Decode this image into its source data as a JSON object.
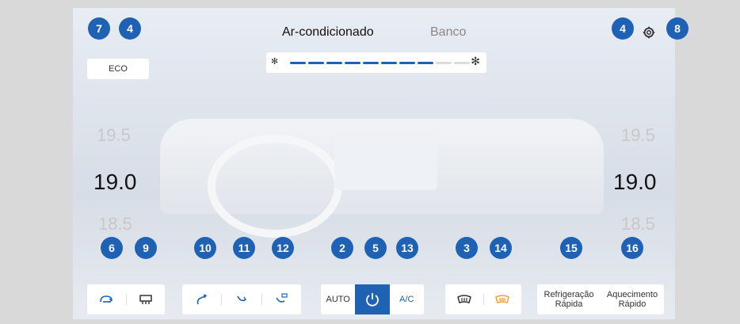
{
  "header": {
    "tab_ac": "Ar-condicionado",
    "tab_seat": "Banco",
    "settings_icon": "gear-icon"
  },
  "eco_label": "ECO",
  "fan": {
    "level": 0.78,
    "small_icon": "fan-small-icon",
    "large_icon": "fan-large-icon",
    "active_color": "#1f62b4",
    "inactive_color": "#dcdcdc"
  },
  "temps": {
    "left_upper": "19.5",
    "left_current": "19.0",
    "left_lower": "18.5",
    "right_upper": "19.5",
    "right_current": "19.0",
    "right_lower": "18.5"
  },
  "badges": {
    "b7": "7",
    "b4a": "4",
    "b4b": "4",
    "b8": "8",
    "b6": "6",
    "b9": "9",
    "b10": "10",
    "b11": "11",
    "b12": "12",
    "b2": "2",
    "b5": "5",
    "b13": "13",
    "b3": "3",
    "b14": "14",
    "b15": "15",
    "b16": "16"
  },
  "controls": {
    "recirc": "recirculation-icon",
    "rear_defrost": "rear-defrost-icon",
    "airflow_face": "airflow-face-icon",
    "airflow_feet": "airflow-feet-icon",
    "airflow_windshield_feet": "airflow-windshield-feet-icon",
    "auto_label": "AUTO",
    "power": "power-icon",
    "ac_label": "A/C",
    "front_defrost": "front-defrost-icon",
    "front_defrost_max": "max-defrost-icon",
    "rapid_cool_line1": "Refrigeração",
    "rapid_cool_line2": "Rápida",
    "rapid_heat_line1": "Aquecimento",
    "rapid_heat_line2": "Rápido"
  },
  "colors": {
    "badge": "#1f62b4",
    "accent": "#1f62b4",
    "heat_icon": "#e8a33a"
  }
}
